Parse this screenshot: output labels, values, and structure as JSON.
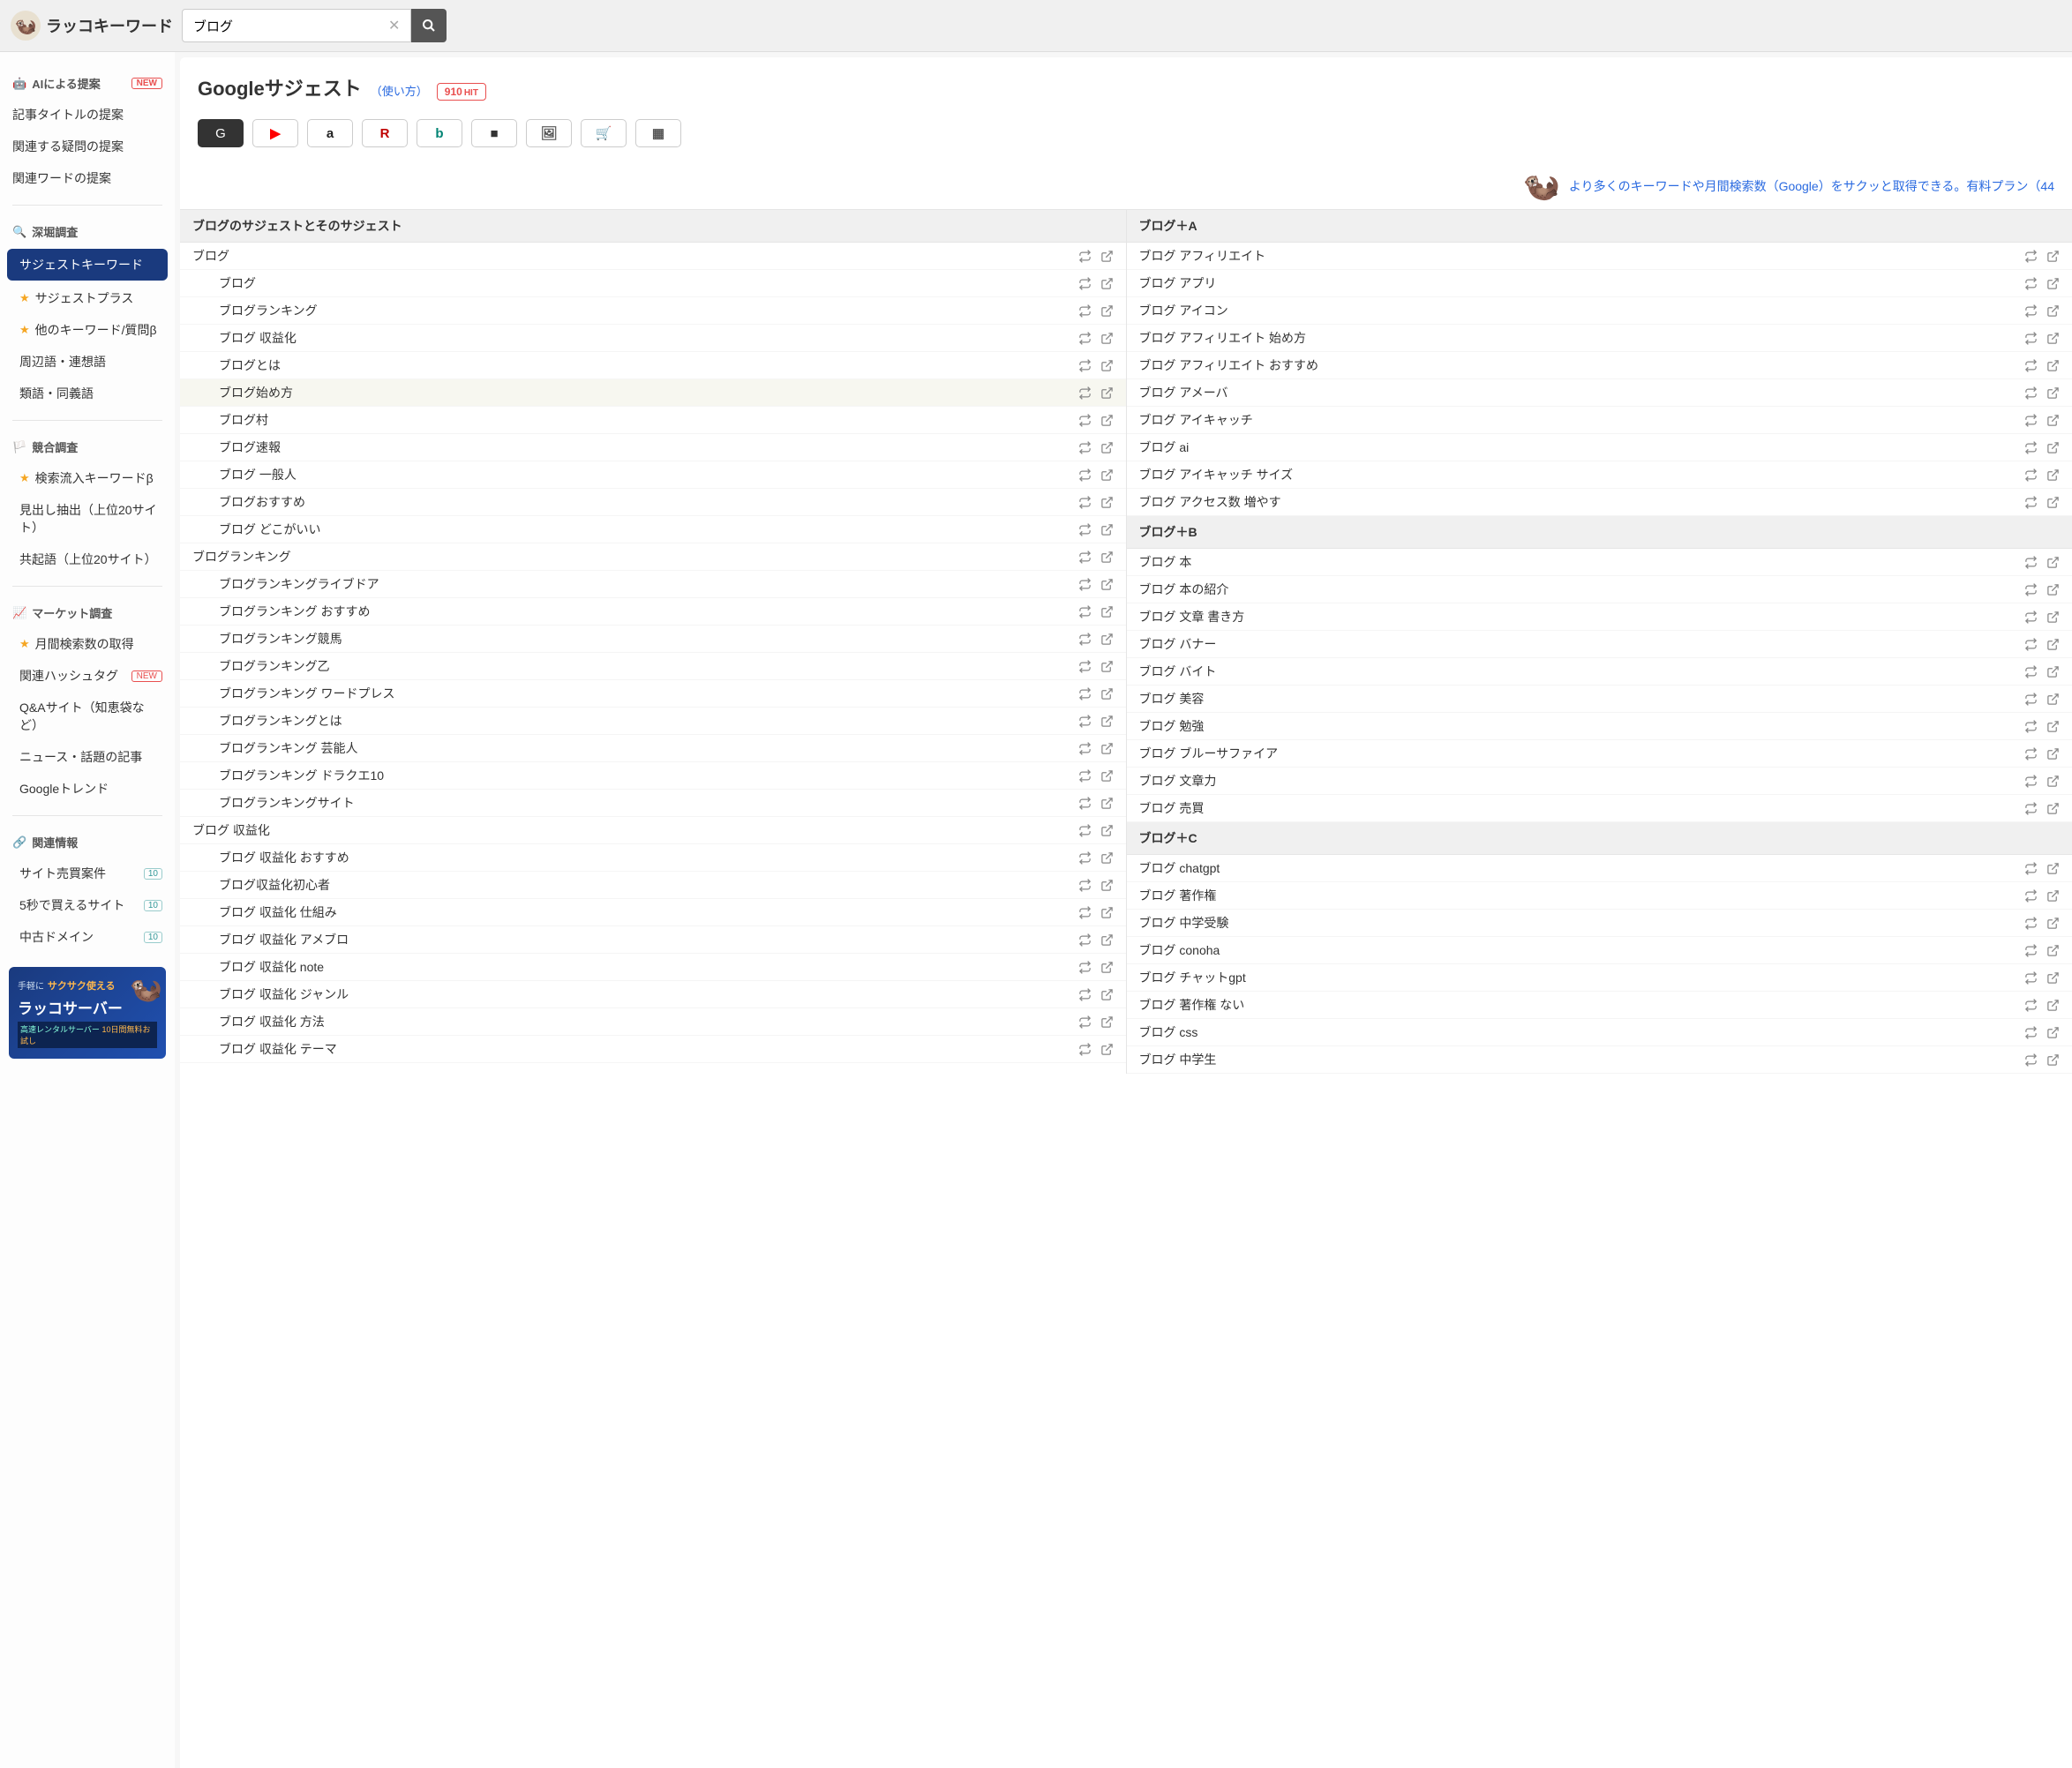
{
  "app": {
    "name": "ラッコキーワード"
  },
  "search": {
    "value": "ブログ"
  },
  "sidebar": {
    "ai": {
      "heading": "AIによる提案",
      "new": "NEW",
      "items": [
        "記事タイトルの提案",
        "関連する疑問の提案",
        "関連ワードの提案"
      ]
    },
    "deep": {
      "heading": "深堀調査",
      "items": [
        {
          "label": "サジェストキーワード",
          "active": true
        },
        {
          "label": "サジェストプラス",
          "star": true
        },
        {
          "label": "他のキーワード/質問β",
          "star": true
        },
        {
          "label": "周辺語・連想語"
        },
        {
          "label": "類語・同義語"
        }
      ]
    },
    "compete": {
      "heading": "競合調査",
      "items": [
        {
          "label": "検索流入キーワードβ",
          "star": true
        },
        {
          "label": "見出し抽出（上位20サイト）"
        },
        {
          "label": "共起語（上位20サイト）"
        }
      ]
    },
    "market": {
      "heading": "マーケット調査",
      "items": [
        {
          "label": "月間検索数の取得",
          "star": true
        },
        {
          "label": "関連ハッシュタグ",
          "new": "NEW"
        },
        {
          "label": "Q&Aサイト（知恵袋など）"
        },
        {
          "label": "ニュース・話題の記事"
        },
        {
          "label": "Googleトレンド"
        }
      ]
    },
    "related": {
      "heading": "関連情報",
      "items": [
        {
          "label": "サイト売買案件",
          "count": "10"
        },
        {
          "label": "5秒で買えるサイト",
          "count": "10"
        },
        {
          "label": "中古ドメイン",
          "count": "10"
        }
      ]
    }
  },
  "promo": {
    "small": "手軽に",
    "accent": "サクサク使える",
    "title": "ラッコサーバー",
    "sub1": "高速レンタルサーバー",
    "sub2": "10日間無料お試し"
  },
  "page": {
    "title": "Googleサジェスト",
    "usage": "（使い方）",
    "hit_num": "910",
    "hit_label": "HIT",
    "banner": "より多くのキーワードや月間検索数（Google）をサクッと取得できる。有料プラン（44"
  },
  "sources": [
    {
      "name": "google",
      "glyph": "G",
      "active": true
    },
    {
      "name": "youtube",
      "glyph": "▶",
      "color": "#ff0000"
    },
    {
      "name": "amazon",
      "glyph": "a",
      "color": "#222"
    },
    {
      "name": "rakuten",
      "glyph": "R",
      "color": "#bf0000"
    },
    {
      "name": "bing",
      "glyph": "b",
      "color": "#008373"
    },
    {
      "name": "video",
      "glyph": "■",
      "color": "#333"
    },
    {
      "name": "image",
      "glyph": "🖼",
      "color": "#555"
    },
    {
      "name": "shopping",
      "glyph": "🛒",
      "color": "#555"
    },
    {
      "name": "apps",
      "glyph": "▦",
      "color": "#555"
    }
  ],
  "left": {
    "head": "ブログのサジェストとそのサジェスト",
    "groups": [
      {
        "parent": "ブログ",
        "children": [
          {
            "t": "ブログ"
          },
          {
            "t": "ブログランキング"
          },
          {
            "t": "ブログ 収益化"
          },
          {
            "t": "ブログとは"
          },
          {
            "t": "ブログ始め方",
            "hl": true
          },
          {
            "t": "ブログ村"
          },
          {
            "t": "ブログ速報"
          },
          {
            "t": "ブログ 一般人"
          },
          {
            "t": "ブログおすすめ"
          },
          {
            "t": "ブログ どこがいい"
          }
        ]
      },
      {
        "parent": "ブログランキング",
        "children": [
          {
            "t": "ブログランキングライブドア"
          },
          {
            "t": "ブログランキング おすすめ"
          },
          {
            "t": "ブログランキング競馬"
          },
          {
            "t": "ブログランキング乙"
          },
          {
            "t": "ブログランキング ワードプレス"
          },
          {
            "t": "ブログランキングとは"
          },
          {
            "t": "ブログランキング 芸能人"
          },
          {
            "t": "ブログランキング ドラクエ10"
          },
          {
            "t": "ブログランキングサイト"
          }
        ]
      },
      {
        "parent": "ブログ 収益化",
        "children": [
          {
            "t": "ブログ 収益化 おすすめ"
          },
          {
            "t": "ブログ収益化初心者"
          },
          {
            "t": "ブログ 収益化 仕組み"
          },
          {
            "t": "ブログ 収益化 アメブロ"
          },
          {
            "t": "ブログ 収益化 note"
          },
          {
            "t": "ブログ 収益化 ジャンル"
          },
          {
            "t": "ブログ 収益化 方法"
          },
          {
            "t": "ブログ 収益化 テーマ"
          }
        ]
      }
    ]
  },
  "right": {
    "sections": [
      {
        "head": "ブログ＋A",
        "items": [
          "ブログ アフィリエイト",
          "ブログ アプリ",
          "ブログ アイコン",
          "ブログ アフィリエイト 始め方",
          "ブログ アフィリエイト おすすめ",
          "ブログ アメーバ",
          "ブログ アイキャッチ",
          "ブログ ai",
          "ブログ アイキャッチ サイズ",
          "ブログ アクセス数 増やす"
        ]
      },
      {
        "head": "ブログ＋B",
        "items": [
          "ブログ 本",
          "ブログ 本の紹介",
          "ブログ 文章 書き方",
          "ブログ バナー",
          "ブログ バイト",
          "ブログ 美容",
          "ブログ 勉強",
          "ブログ ブルーサファイア",
          "ブログ 文章力",
          "ブログ 売買"
        ]
      },
      {
        "head": "ブログ＋C",
        "items": [
          "ブログ chatgpt",
          "ブログ 著作権",
          "ブログ 中学受験",
          "ブログ conoha",
          "ブログ チャットgpt",
          "ブログ 著作権 ない",
          "ブログ css",
          "ブログ 中学生"
        ]
      }
    ]
  }
}
